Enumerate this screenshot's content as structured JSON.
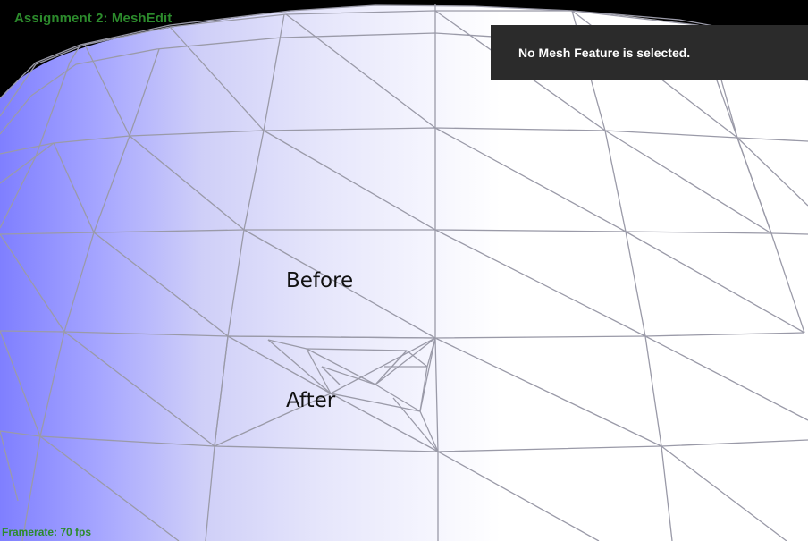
{
  "app": {
    "title": "Assignment 2: MeshEdit"
  },
  "status": {
    "framerate": "Framerate: 70 fps"
  },
  "info_panel": {
    "message": "No Mesh Feature is selected."
  },
  "annotations": {
    "before": "Before",
    "after": "After"
  },
  "colors": {
    "background": "#000000",
    "hud_text": "#2c8a2c",
    "panel_bg": "#2b2b2b",
    "mesh_edge": "#9a9aa8",
    "mesh_fill_shaded": "#8c8cff",
    "mesh_fill_lit": "#ffffff"
  }
}
